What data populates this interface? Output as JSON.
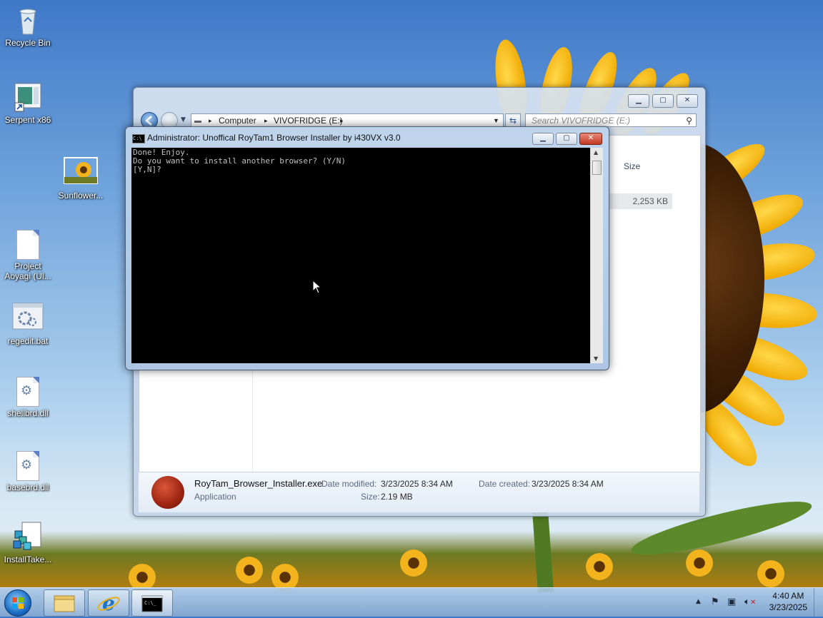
{
  "desktop": {
    "icons": [
      {
        "label": "Recycle Bin"
      },
      {
        "label": "Serpent x86"
      },
      {
        "label": "Sunflower..."
      },
      {
        "label": "Project Aoyagi (Ul..."
      },
      {
        "label": "regedit.bat"
      },
      {
        "label": "shellbrd.dll"
      },
      {
        "label": "basebrd.dll"
      },
      {
        "label": "InstallTake..."
      }
    ]
  },
  "explorer": {
    "breadcrumb": [
      "Computer",
      "VIVOFRIDGE (E:)"
    ],
    "search_placeholder": "Search VIVOFRIDGE (E:)",
    "column_size": "Size",
    "row_size": "2,253 KB",
    "details": {
      "filename": "RoyTam_Browser_Installer.exe",
      "type": "Application",
      "date_modified_label": "Date modified:",
      "date_modified": "3/23/2025 8:34 AM",
      "size_label": "Size:",
      "size": "2.19 MB",
      "date_created_label": "Date created:",
      "date_created": "3/23/2025 8:34 AM"
    }
  },
  "console": {
    "title": "Administrator:  Unoffical RoyTam1 Browser Installer by i430VX v3.0",
    "lines": [
      "Done! Enjoy.",
      "Do you want to install another browser? (Y/N)",
      "[Y,N]?"
    ]
  },
  "taskbar": {
    "time": "4:40 AM",
    "date": "3/23/2025"
  }
}
